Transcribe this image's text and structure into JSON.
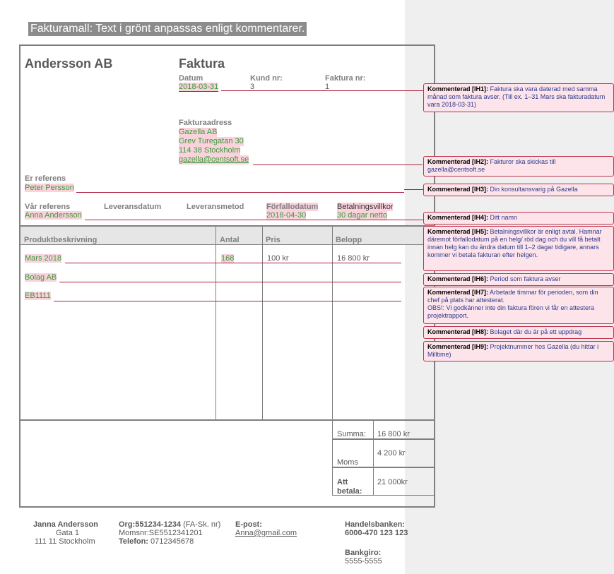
{
  "banner": "Fakturamall:   Text i grönt anpassas enligt kommentarer.",
  "invoice": {
    "company": "Andersson AB",
    "title": "Faktura",
    "date_label": "Datum",
    "date_value": "2018-03-31",
    "customer_label": "Kund nr:",
    "customer_value": "3",
    "invoice_no_label": "Faktura nr:",
    "invoice_no_value": "1",
    "address_label": "Fakturaadress",
    "address_lines": [
      "Gazella AB",
      "Grev Turegatan 30",
      "114 38 Stockholm"
    ],
    "address_email": "gazella@centsoft.se",
    "their_ref_label": "Er referens",
    "their_ref_value": "Peter Persson",
    "our_ref_label": "Vår referens",
    "our_ref_value": "Anna Andersson",
    "delivery_date_label": "Leveransdatum",
    "delivery_method_label": "Leveransmetod",
    "due_date_label": "Förfallodatum",
    "due_date_value": "2018-04-30",
    "payment_terms_label": "Betalningsvillkor",
    "payment_terms_value": "30 dagar netto"
  },
  "table": {
    "headers": [
      "Produktbeskrivning",
      "Antal",
      "Pris",
      "Belopp"
    ],
    "rows": [
      {
        "description": "Mars 2018",
        "quantity": "168",
        "price": "100 kr",
        "amount": "16 800 kr"
      },
      {
        "description": "Bolag AB",
        "quantity": "",
        "price": "",
        "amount": ""
      },
      {
        "description": "EB1111",
        "quantity": "",
        "price": "",
        "amount": ""
      }
    ]
  },
  "totals": {
    "sum_label": "Summa:",
    "sum_value": "16 800 kr",
    "vat_label": "Moms",
    "vat_value": "4 200 kr",
    "pay_label_1": "Att",
    "pay_label_2": "betala:",
    "pay_value": "21 000kr"
  },
  "footer": {
    "name": "Janna Andersson",
    "street": "Gata 1",
    "city": "111 11 Stockholm",
    "org_label": "Org:551234-1234",
    "org_suffix": " (FA-Sk. nr)",
    "vat_no": "Momsnr:SE5512341201",
    "phone_label": "Telefon:",
    "phone_value": " 0712345678",
    "email_label": "E-post:",
    "email_value": "Anna@gmail.com",
    "bank_label": "Handelsbanken:",
    "bank_value": "6000-470 123 123",
    "bankgiro_label": "Bankgiro:",
    "bankgiro_value": "5555-5555"
  },
  "comments": [
    {
      "tag": "Kommenterad [IH1]:",
      "text": " Faktura ska vara daterad med samma månad som faktura avser. (Till ex. 1–31 Mars ska fakturadatum vara 2018-03-31)"
    },
    {
      "tag": "Kommenterad [IH2]:",
      "text": " Fakturor ska skickas till gazella@centsoft.se"
    },
    {
      "tag": "Kommenterad [IH3]:",
      "text": " Din konsultansvarig på Gazella"
    },
    {
      "tag": "Kommenterad [IH4]:",
      "text": " Ditt namn"
    },
    {
      "tag": "Kommenterad [IH5]:",
      "text": " Betalningsvillkor är enligt avtal. Hamnar däremot förfallodatum på en helg/ röd dag och du vill få betalt innan helg kan du ändra datum till 1–2 dagar tidigare, annars kommer vi betala fakturan efter helgen."
    },
    {
      "tag": "Kommenterad [IH6]:",
      "text": " Period som faktura avser"
    },
    {
      "tag": "Kommenterad [IH7]:",
      "text": " Arbetade timmar för perioden, som din chef på plats har attesterat.\nOBS!: Vi godkänner inte din faktura fören vi får en attestera projektrapport."
    },
    {
      "tag": "Kommenterad [IH8]:",
      "text": " Bolaget där du är på ett uppdrag"
    },
    {
      "tag": "Kommenterad [IH9]:",
      "text": " Projektnummer hos Gazella (du hittar i Milltime)"
    }
  ],
  "colors": {
    "green_text": "#3a9a3a",
    "highlight": "#f9d2dc",
    "comment_bg": "#fde4ea",
    "comment_border": "#c0304a"
  }
}
